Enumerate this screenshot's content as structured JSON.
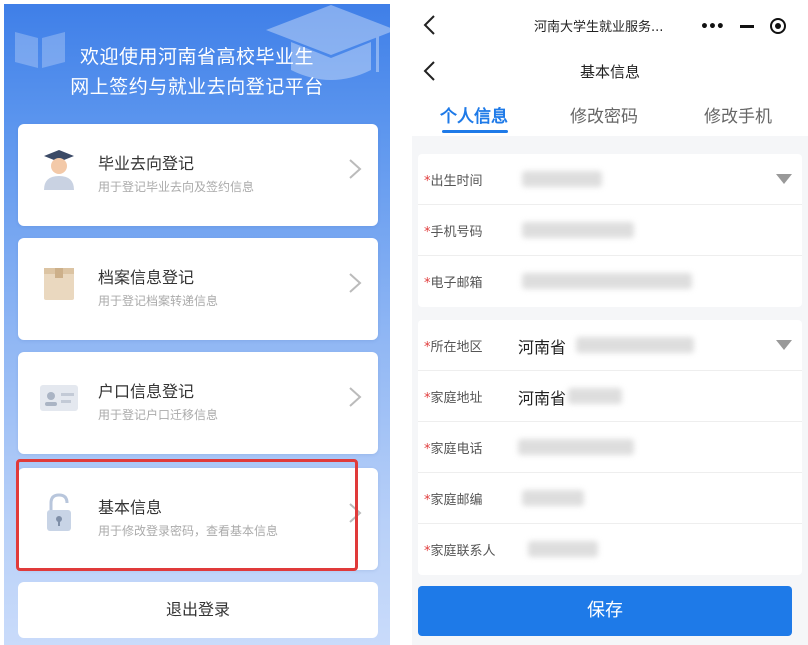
{
  "left_screen": {
    "welcome_line1": "欢迎使用河南省高校毕业生",
    "welcome_line2": "网上签约与就业去向登记平台",
    "cards": [
      {
        "title": "毕业去向登记",
        "subtitle": "用于登记毕业去向及签约信息",
        "icon": "graduate-icon"
      },
      {
        "title": "档案信息登记",
        "subtitle": "用于登记档案转递信息",
        "icon": "archive-box-icon"
      },
      {
        "title": "户口信息登记",
        "subtitle": "用于登记户口迁移信息",
        "icon": "id-card-icon"
      },
      {
        "title": "基本信息",
        "subtitle": "用于修改登录密码，查看基本信息",
        "icon": "lock-icon"
      }
    ],
    "logout_label": "退出登录",
    "highlight_color": "#e03a3a",
    "accent": "#3f7fe8"
  },
  "right_screen": {
    "app_title": "河南大学生就业服务...",
    "capsule": {
      "more": "•••"
    },
    "nav_title": "基本信息",
    "tabs": [
      {
        "label": "个人信息",
        "active": true
      },
      {
        "label": "修改密码",
        "active": false
      },
      {
        "label": "修改手机",
        "active": false
      }
    ],
    "group1": [
      {
        "label": "出生时间",
        "value": "",
        "dropdown": true
      },
      {
        "label": "手机号码",
        "value": ""
      },
      {
        "label": "电子邮箱",
        "value": ""
      }
    ],
    "group2": [
      {
        "label": "所在地区",
        "value": "河南省",
        "dropdown": true
      },
      {
        "label": "家庭地址",
        "value": "河南省"
      },
      {
        "label": "家庭电话",
        "value": ""
      },
      {
        "label": "家庭邮编",
        "value": ""
      },
      {
        "label": "家庭联系人",
        "value": ""
      }
    ],
    "required_mark": "*",
    "save_label": "保存",
    "accent": "#1e7ae8"
  }
}
